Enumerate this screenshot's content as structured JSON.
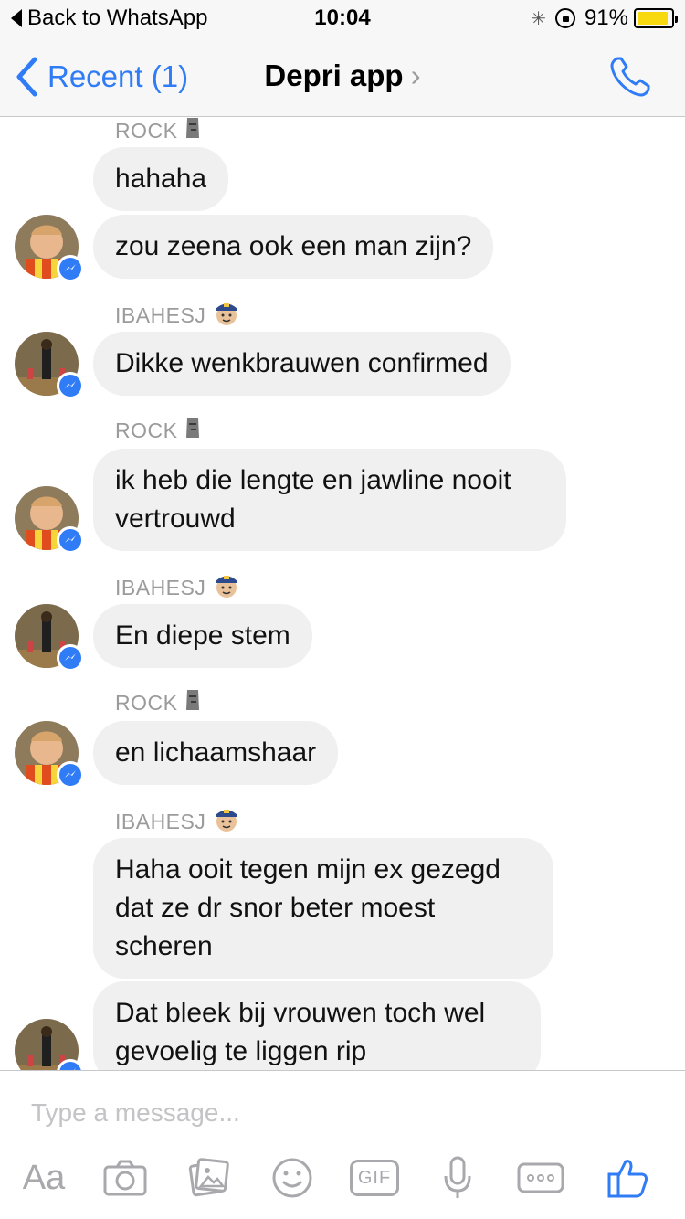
{
  "status_bar": {
    "back_label": "Back to WhatsApp",
    "time": "10:04",
    "battery": "91%",
    "battery_level": 0.91
  },
  "nav": {
    "back_label": "Recent (1)",
    "title": "Depri app",
    "title_chevron": "›"
  },
  "messages": [
    {
      "sender": "ROCK",
      "sender_emoji": "moai-icon",
      "text": "hahaha",
      "avatar": "kid-avatar"
    },
    {
      "sender": "",
      "text": "zou zeena ook een man zijn?",
      "avatar": "kid-avatar"
    },
    {
      "sender": "IBAHESJ",
      "sender_emoji": "police-officer-icon",
      "text": "Dikke wenkbrauwen confirmed",
      "avatar": "gym-avatar"
    },
    {
      "sender": "ROCK",
      "sender_emoji": "moai-icon",
      "text": "ik heb die lengte en jawline nooit\nvertrouwd",
      "avatar": "kid-avatar"
    },
    {
      "sender": "IBAHESJ",
      "sender_emoji": "police-officer-icon",
      "text": "En diepe stem",
      "avatar": "gym-avatar"
    },
    {
      "sender": "ROCK",
      "sender_emoji": "moai-icon",
      "text": "en lichaamshaar",
      "avatar": "kid-avatar"
    },
    {
      "sender": "IBAHESJ",
      "sender_emoji": "police-officer-icon",
      "text": "Haha ooit tegen mijn ex gezegd\ndat ze dr snor beter moest\nscheren",
      "avatar": "gym-avatar"
    },
    {
      "sender": "",
      "text": "Dat bleek bij vrouwen toch wel\ngevoelig te liggen rip",
      "avatar": "gym-avatar"
    }
  ],
  "composer": {
    "placeholder": "Type a message...",
    "aa_label": "Aa",
    "gif_label": "GIF"
  },
  "colors": {
    "accent": "#2f7cf6",
    "bubble": "#f1f0f0",
    "battery": "#f8d90f"
  }
}
